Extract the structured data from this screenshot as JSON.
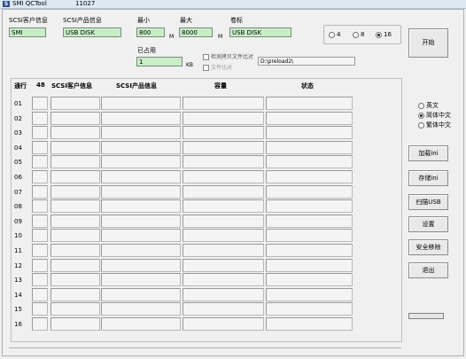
{
  "window": {
    "title": "SMI QCTool",
    "version": "11027",
    "icon": "smi-logo-icon"
  },
  "fields": {
    "scsi_vendor": {
      "label": "SCSI客户信息",
      "value": "SMI"
    },
    "scsi_product": {
      "label": "SCSI产品信息",
      "value": "USB DISK"
    },
    "min": {
      "label": "最小",
      "value": "800",
      "unit": "M"
    },
    "max": {
      "label": "最大",
      "value": "8000",
      "unit": "M"
    },
    "volume_label": {
      "label": "卷标",
      "value": "USB DISK"
    },
    "used": {
      "label": "已占用",
      "value": "1",
      "unit": "KB"
    }
  },
  "checkboxes": [
    {
      "label": "检测拷贝文件比对",
      "checked": false
    },
    {
      "label": "文件比对",
      "checked": false
    }
  ],
  "path": {
    "value": "D:\\preload2\\"
  },
  "ports_radio": {
    "options": [
      "4",
      "8",
      "16"
    ],
    "selected": "16"
  },
  "buttons": {
    "start": "开始",
    "read_ini": "加载ini",
    "save_ini": "存储ini",
    "scan_usb": "扫描USB",
    "settings": "设置",
    "safe_remove": "安全移除",
    "exit": "退出"
  },
  "language": {
    "options": [
      "英文",
      "简体中文",
      "繁体中文"
    ],
    "selected": "简体中文"
  },
  "table": {
    "headers": {
      "port": "通行",
      "count": "48",
      "vendor": "SCSI客户信息",
      "product": "SCSI产品信息",
      "capacity": "容量",
      "status": "状态"
    },
    "rows": [
      "01",
      "02",
      "03",
      "04",
      "05",
      "06",
      "07",
      "08",
      "09",
      "10",
      "11",
      "12",
      "13",
      "14",
      "15",
      "16"
    ]
  }
}
